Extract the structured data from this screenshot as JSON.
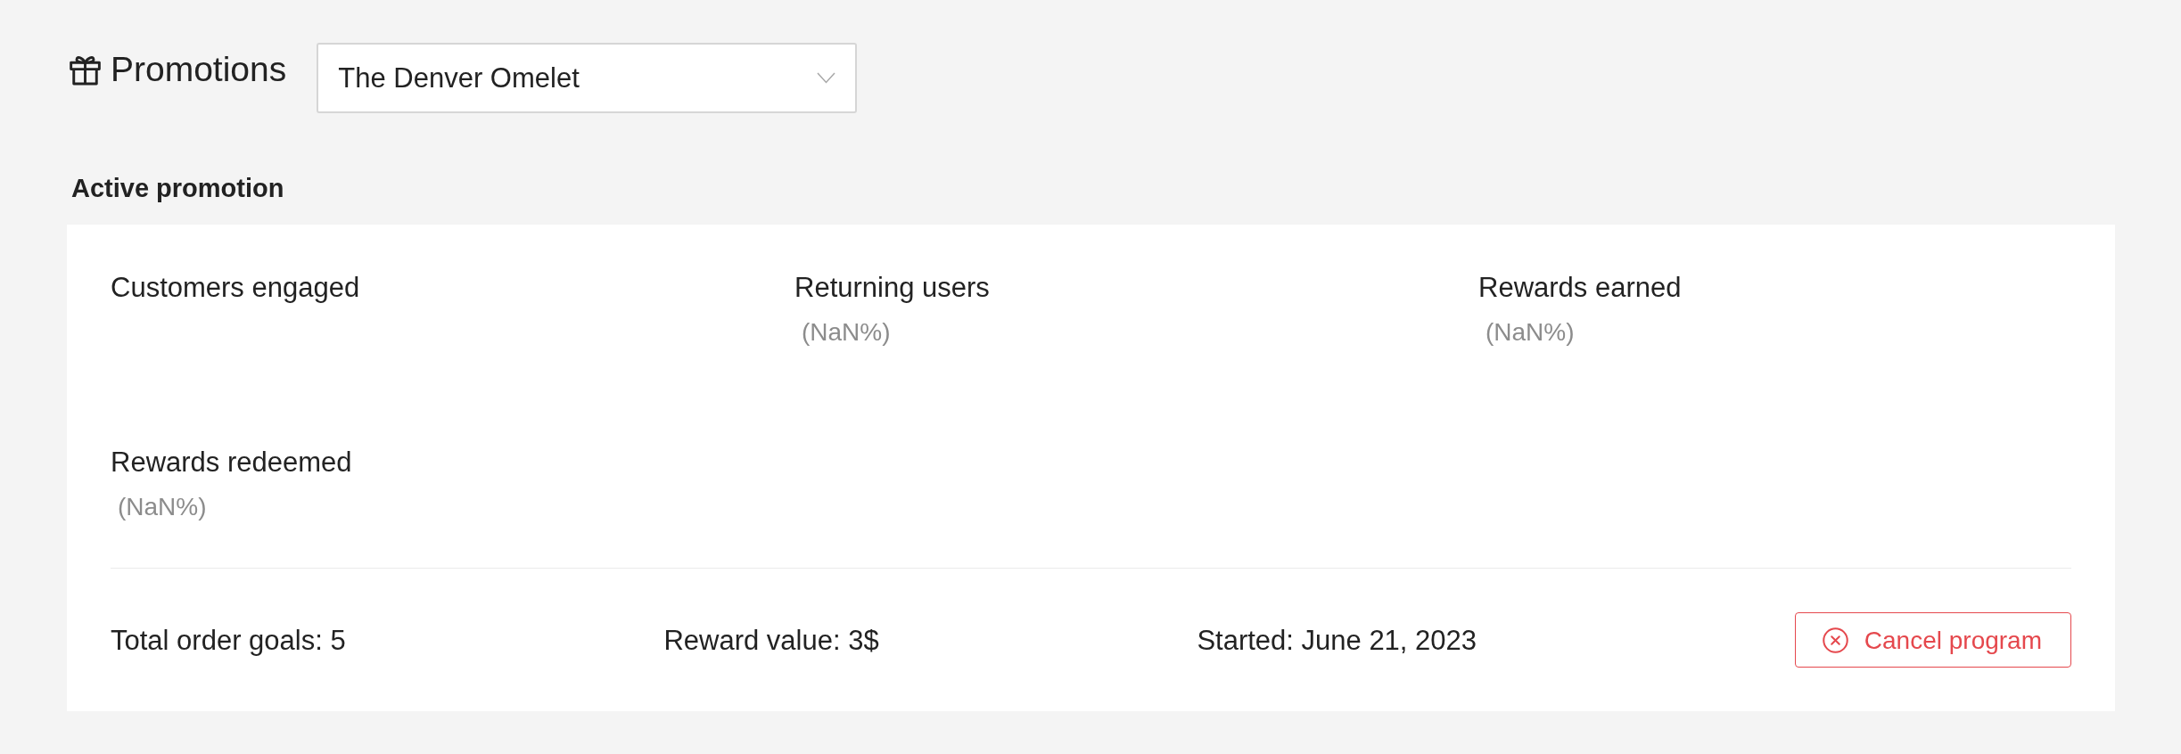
{
  "header": {
    "title": "Promotions",
    "promotion_select": {
      "value": "The Denver Omelet"
    }
  },
  "section_title": "Active promotion",
  "stats": [
    {
      "label": "Customers engaged"
    },
    {
      "label": "Returning users",
      "percent": "(NaN%)"
    },
    {
      "label": "Rewards earned",
      "percent": "(NaN%)"
    },
    {
      "label": "Rewards redeemed",
      "percent": "(NaN%)"
    }
  ],
  "details": [
    "Total order goals: 5",
    "Reward value: 3$",
    "Started: June 21, 2023"
  ],
  "cancel_button": {
    "label": "Cancel program"
  }
}
